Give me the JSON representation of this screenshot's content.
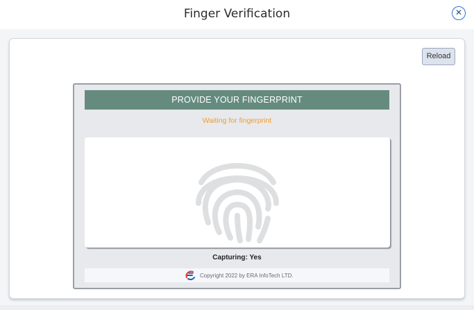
{
  "dialog": {
    "title": "Finger Verification",
    "close_glyph": "✕"
  },
  "toolbar": {
    "reload_label": "Reload"
  },
  "capture": {
    "header": "PROVIDE YOUR FINGERPRINT",
    "status": "Waiting for fingerprint",
    "capturing": "Capturing: Yes",
    "icon": "fingerprint-icon"
  },
  "footer": {
    "copyright": "Copyright 2022 by ERA InfoTech LTD.",
    "logo": "era-logo-icon"
  },
  "colors": {
    "header_bg": "#658b7f",
    "status_text": "#f29b2e",
    "close_accent": "#2d6fd6"
  }
}
